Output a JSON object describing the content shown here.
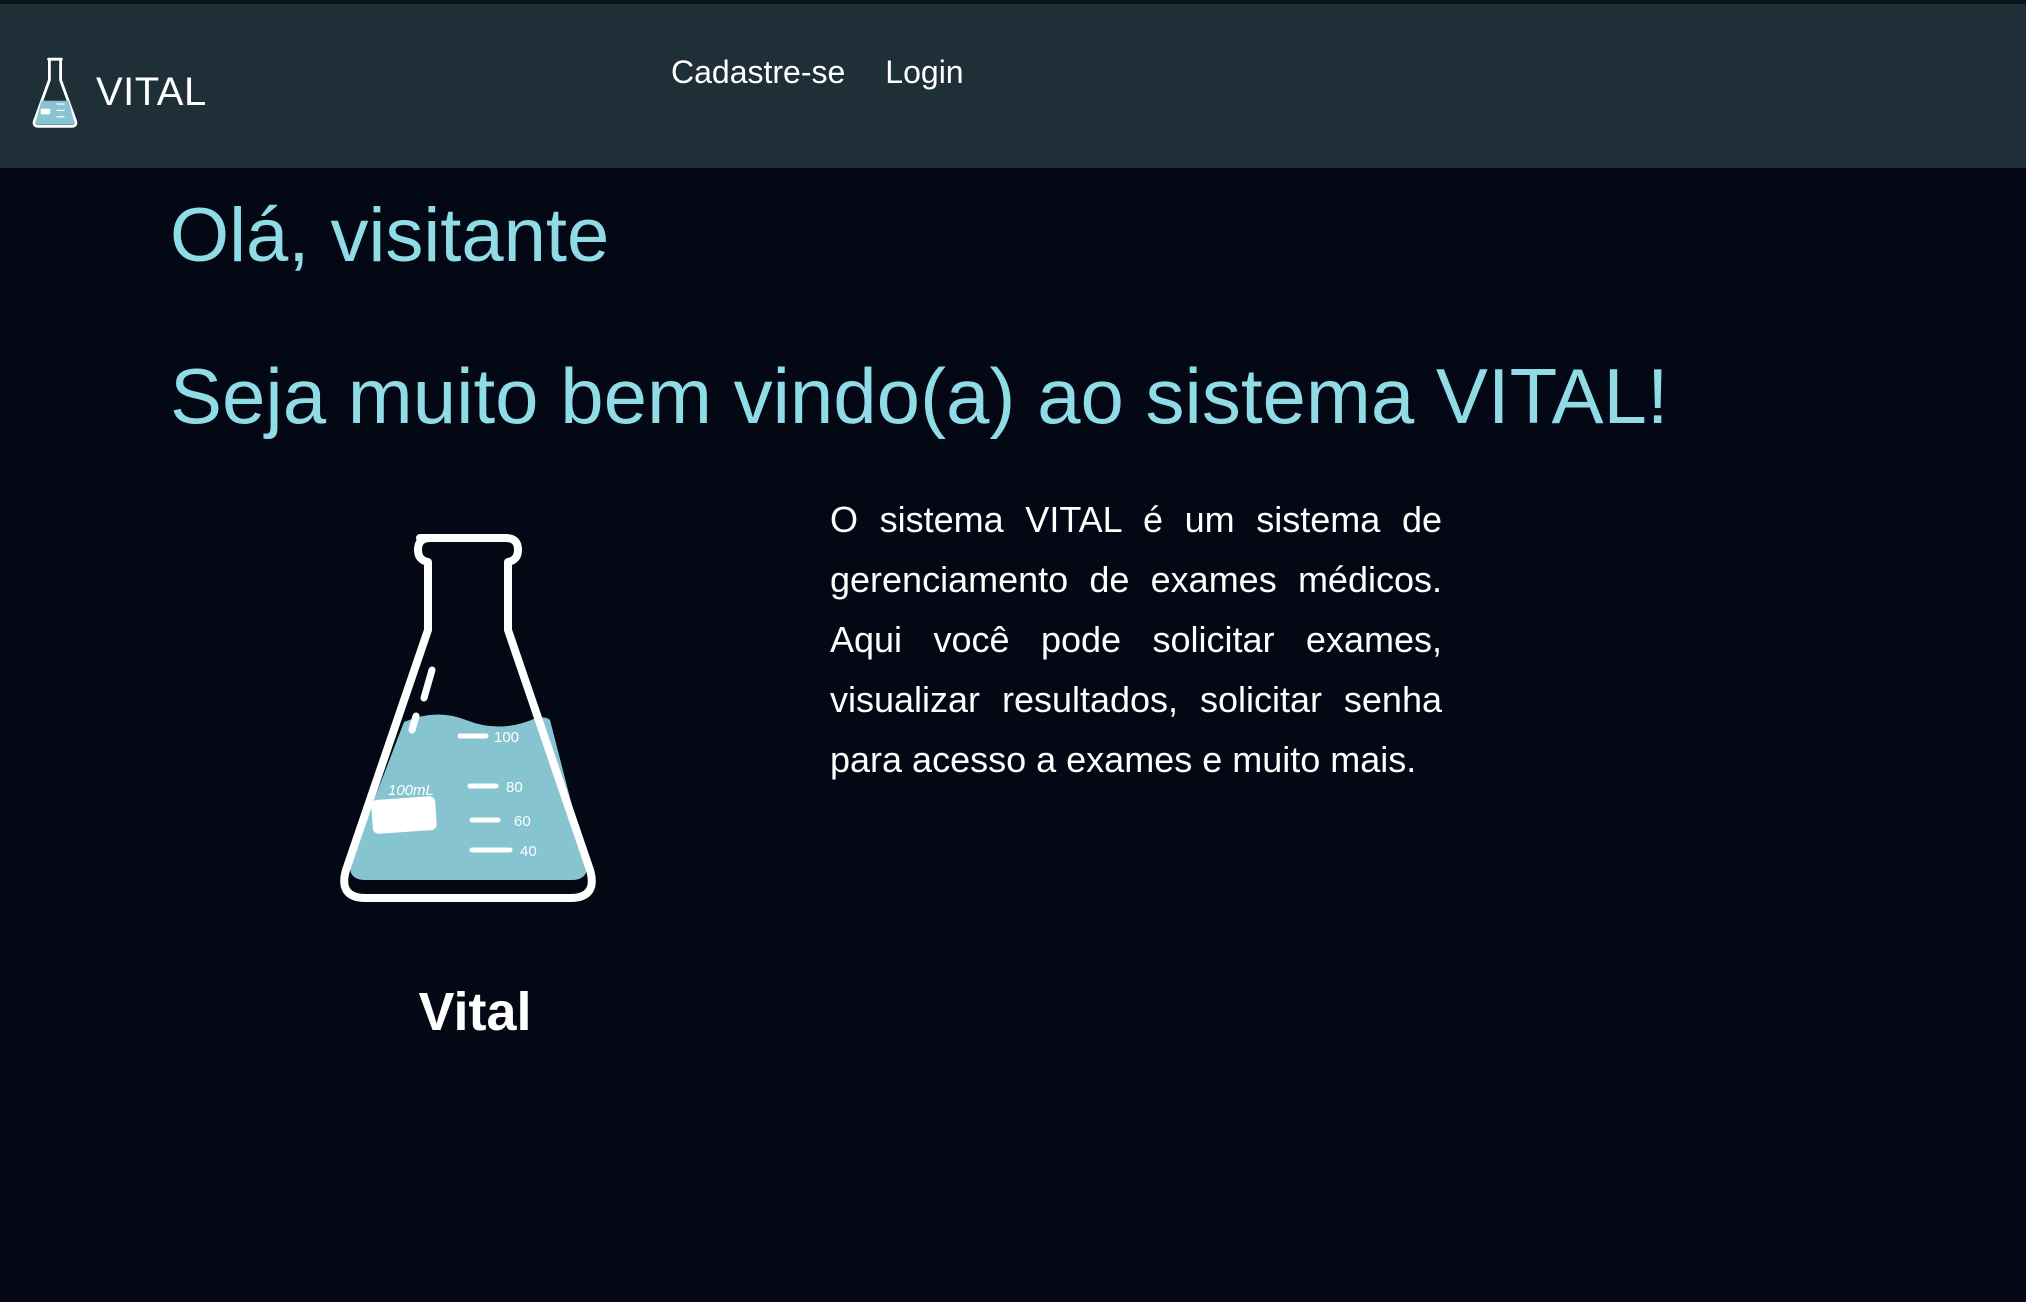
{
  "header": {
    "brand": "VITAL",
    "nav": {
      "signup_label": "Cadastre-se",
      "login_label": "Login"
    }
  },
  "main": {
    "greeting": "Olá, visitante",
    "welcome": "Seja muito bem vindo(a) ao sistema VITAL!",
    "image_caption": "Vital",
    "description": "O sistema VITAL é um sistema de gerenciamento de exames médicos. Aqui você pode solicitar exames, visualizar resultados, solicitar senha para acesso a exames e muito mais.",
    "flask_labels": {
      "volume": "100mL",
      "mark_100": "100",
      "mark_80": "80",
      "mark_60": "60",
      "mark_40": "40"
    }
  },
  "colors": {
    "page_background": "#040814",
    "navbar_background": "#1f2f37",
    "heading": "#8fdbe6",
    "liquid": "#86c4cf",
    "text": "#ffffff"
  },
  "icons": {
    "brand_logo": "flask-icon",
    "hero_image": "flask-icon"
  }
}
